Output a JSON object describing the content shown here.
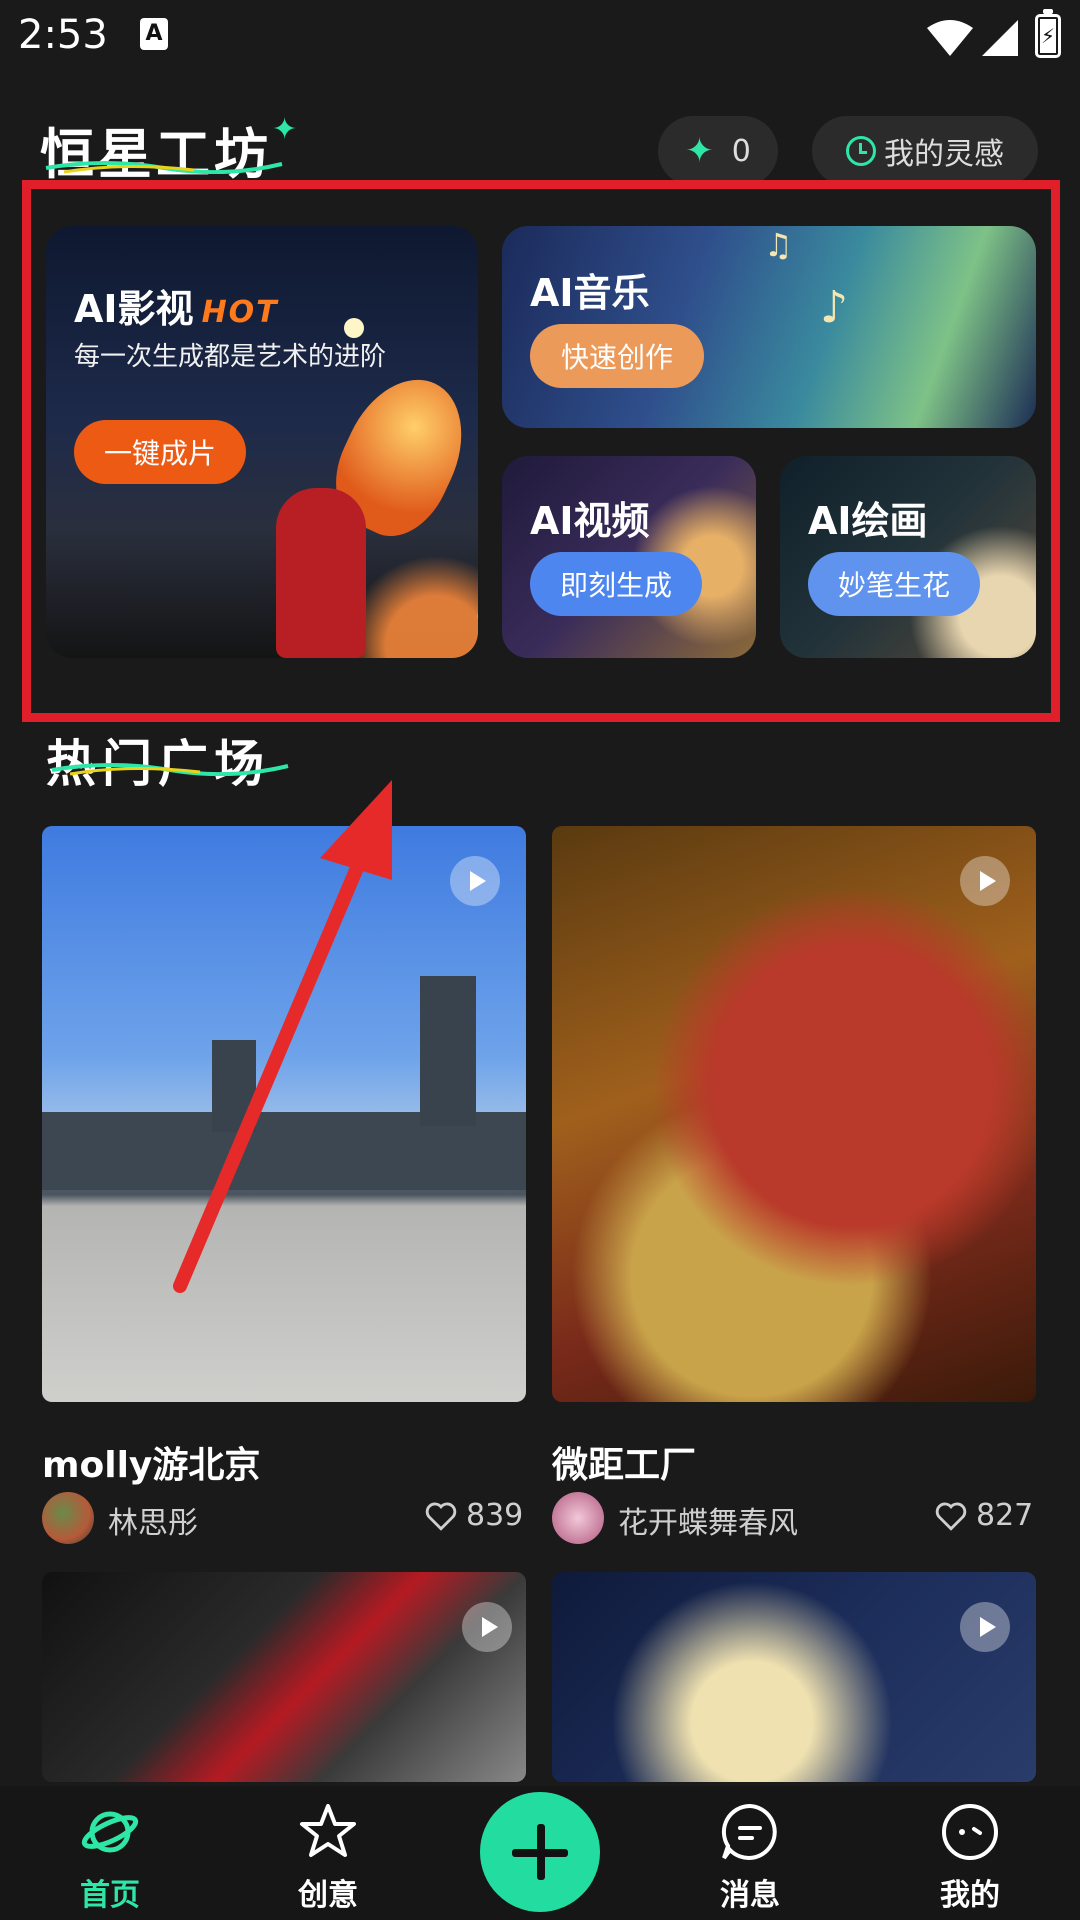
{
  "status_bar": {
    "time": "2:53",
    "notification_badge": "A",
    "icons": [
      "wifi-icon",
      "signal-icon",
      "battery-charging-icon"
    ]
  },
  "header": {
    "brand": "恒星工坊",
    "points_value": "0",
    "inspiration_label": "我的灵感"
  },
  "ai_cards": {
    "film": {
      "title": "AI影视",
      "hot": "HOT",
      "subtitle": "每一次生成都是艺术的进阶",
      "button": "一键成片"
    },
    "music": {
      "title": "AI音乐",
      "button": "快速创作"
    },
    "video": {
      "title": "AI视频",
      "button": "即刻生成"
    },
    "paint": {
      "title": "AI绘画",
      "button": "妙笔生花"
    }
  },
  "section": {
    "title": "热门广场"
  },
  "feed": [
    {
      "title": "molly游北京",
      "author": "林思彤",
      "likes": "839"
    },
    {
      "title": "微距工厂",
      "author": "花开蝶舞春风",
      "likes": "827"
    }
  ],
  "bottom_nav": {
    "items": [
      {
        "label": "首页",
        "icon": "planet-icon",
        "active": true
      },
      {
        "label": "创意",
        "icon": "star-icon",
        "active": false
      },
      {
        "label": "消息",
        "icon": "message-icon",
        "active": false
      },
      {
        "label": "我的",
        "icon": "face-icon",
        "active": false
      }
    ],
    "center_action_icon": "plus-icon"
  },
  "colors": {
    "accent": "#2ee6a6",
    "highlight_box": "#e01f2a",
    "hot": "#ff7a1a",
    "background": "#1a1a1a"
  }
}
